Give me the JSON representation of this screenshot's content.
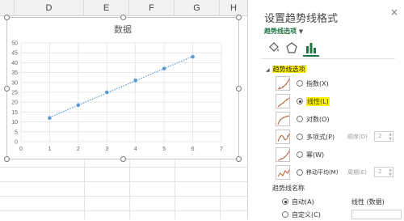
{
  "sheet": {
    "columns": [
      "D",
      "E",
      "F",
      "G",
      "H"
    ]
  },
  "chart_data": {
    "type": "scatter",
    "title": "数据",
    "x": [
      1,
      2,
      3,
      4,
      5,
      6
    ],
    "y": [
      12,
      18.5,
      25,
      31,
      37,
      43
    ],
    "xlim": [
      0,
      7
    ],
    "ylim": [
      0,
      50
    ],
    "xticks": [
      "0",
      "1",
      "2",
      "3",
      "4",
      "5",
      "6",
      "7"
    ],
    "yticks": [
      "0",
      "5",
      "10",
      "15",
      "20",
      "25",
      "30",
      "35",
      "40",
      "45",
      "50"
    ],
    "grid": true,
    "trendline": "linear",
    "colors": {
      "marker": "#5b9bd5",
      "trendline": "#5b9bd5"
    }
  },
  "pane": {
    "title": "设置趋势线格式",
    "close": "×",
    "options_dropdown": "趋势线选项",
    "options_caret": "▼",
    "tabs": [
      "fill-line",
      "effects",
      "trendline-options"
    ],
    "section": "趋势线选项",
    "section_caret": "◢",
    "types": [
      {
        "label": "指数(X)",
        "selected": false
      },
      {
        "label": "线性(L)",
        "selected": true
      },
      {
        "label": "对数(O)",
        "selected": false
      },
      {
        "label": "多项式(P)",
        "selected": false,
        "sub_label": "顺序(D)",
        "sub_value": "2"
      },
      {
        "label": "幂(W)",
        "selected": false
      },
      {
        "label": "移动平均(M)",
        "selected": false,
        "sub_label": "周期(E)",
        "sub_value": "2"
      }
    ],
    "name_section": "趋势线名称",
    "name_auto": "自动(A)",
    "name_auto_value": "线性 (数据)",
    "name_custom": "自定义(C)"
  },
  "colors": {
    "accent": "#217346",
    "highlight": "#fff200"
  }
}
